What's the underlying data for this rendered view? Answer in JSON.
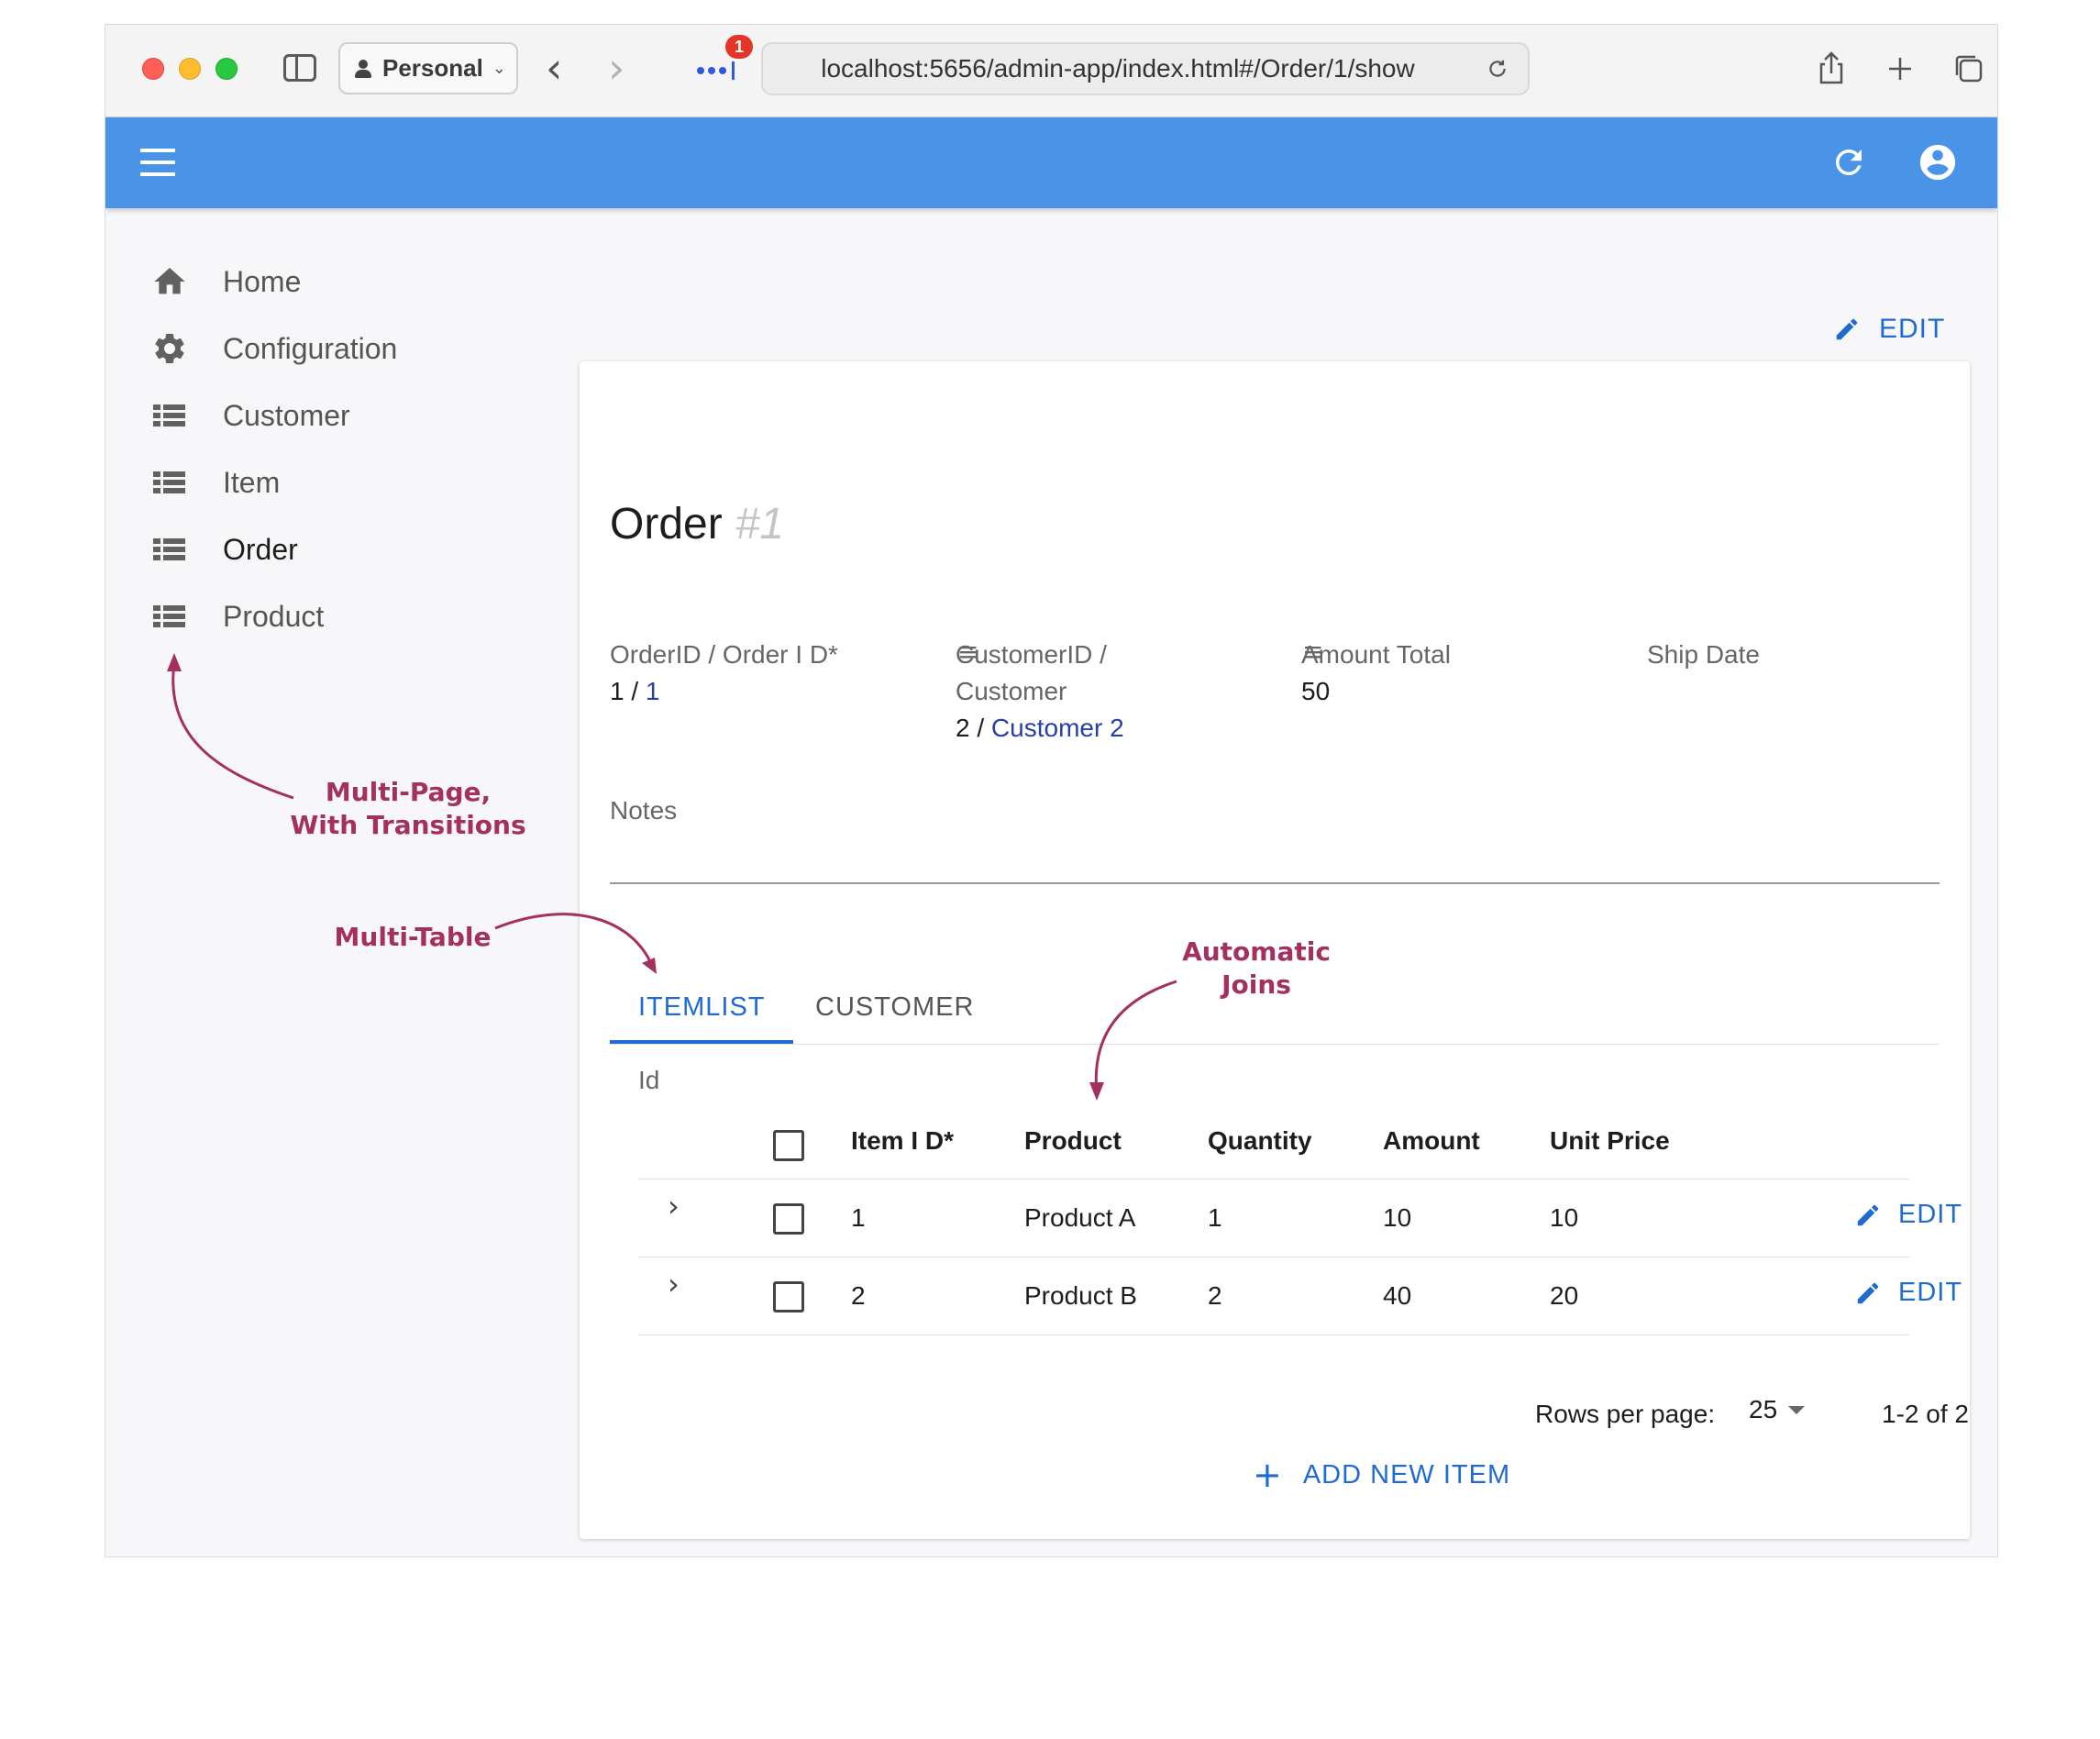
{
  "browser": {
    "profile_label": "Personal",
    "extensions_badge": "1",
    "url": "localhost:5656/admin-app/index.html#/Order/1/show"
  },
  "icons": {
    "menu": "hamburger-menu-icon",
    "refresh": "refresh-icon",
    "account": "account-circle-icon",
    "edit": "pencil-icon",
    "add": "plus-icon"
  },
  "colors": {
    "app_bar": "#4a94e8",
    "accent": "#1f6bd0",
    "link": "#283fa8",
    "annotation": "#a3305e"
  },
  "sidebar": {
    "items": [
      {
        "label": "Home",
        "icon": "home-icon"
      },
      {
        "label": "Configuration",
        "icon": "gear-icon"
      },
      {
        "label": "Customer",
        "icon": "list-icon"
      },
      {
        "label": "Item",
        "icon": "list-icon"
      },
      {
        "label": "Order",
        "icon": "list-icon",
        "active": true
      },
      {
        "label": "Product",
        "icon": "list-icon"
      }
    ]
  },
  "page": {
    "edit_label": "EDIT",
    "title": "Order",
    "record_id": "#1"
  },
  "fields": {
    "order": {
      "label": "OrderID / Order I D*",
      "value_prefix": "1 / ",
      "value_link": "1"
    },
    "customer": {
      "label_line1": "CustomerID /",
      "label_line2": "Customer",
      "value_prefix": "2 / ",
      "value_link": "Customer 2"
    },
    "amount_total": {
      "label": "Amount Total",
      "value": "50"
    },
    "ship_date": {
      "label": "Ship Date",
      "value": ""
    },
    "notes": {
      "label": "Notes",
      "value": ""
    }
  },
  "tabs": [
    {
      "label": "ITEMLIST",
      "active": true
    },
    {
      "label": "CUSTOMER",
      "active": false
    }
  ],
  "itemlist": {
    "id_label": "Id",
    "columns": [
      "Item I D*",
      "Product",
      "Quantity",
      "Amount",
      "Unit Price"
    ],
    "rows": [
      {
        "item_id": "1",
        "product": "Product A",
        "quantity": "1",
        "amount": "10",
        "unit_price": "10",
        "edit_label": "EDIT"
      },
      {
        "item_id": "2",
        "product": "Product B",
        "quantity": "2",
        "amount": "40",
        "unit_price": "20",
        "edit_label": "EDIT"
      }
    ],
    "rows_per_page_label": "Rows per page:",
    "rows_per_page": "25",
    "page_range": "1-2 of 2",
    "add_new_label": "ADD NEW ITEM"
  },
  "annotations": {
    "multi_page_line1": "Multi-Page,",
    "multi_page_line2": "With Transitions",
    "multi_table": "Multi-Table",
    "automatic_joins_line1": "Automatic",
    "automatic_joins_line2": "Joins"
  }
}
